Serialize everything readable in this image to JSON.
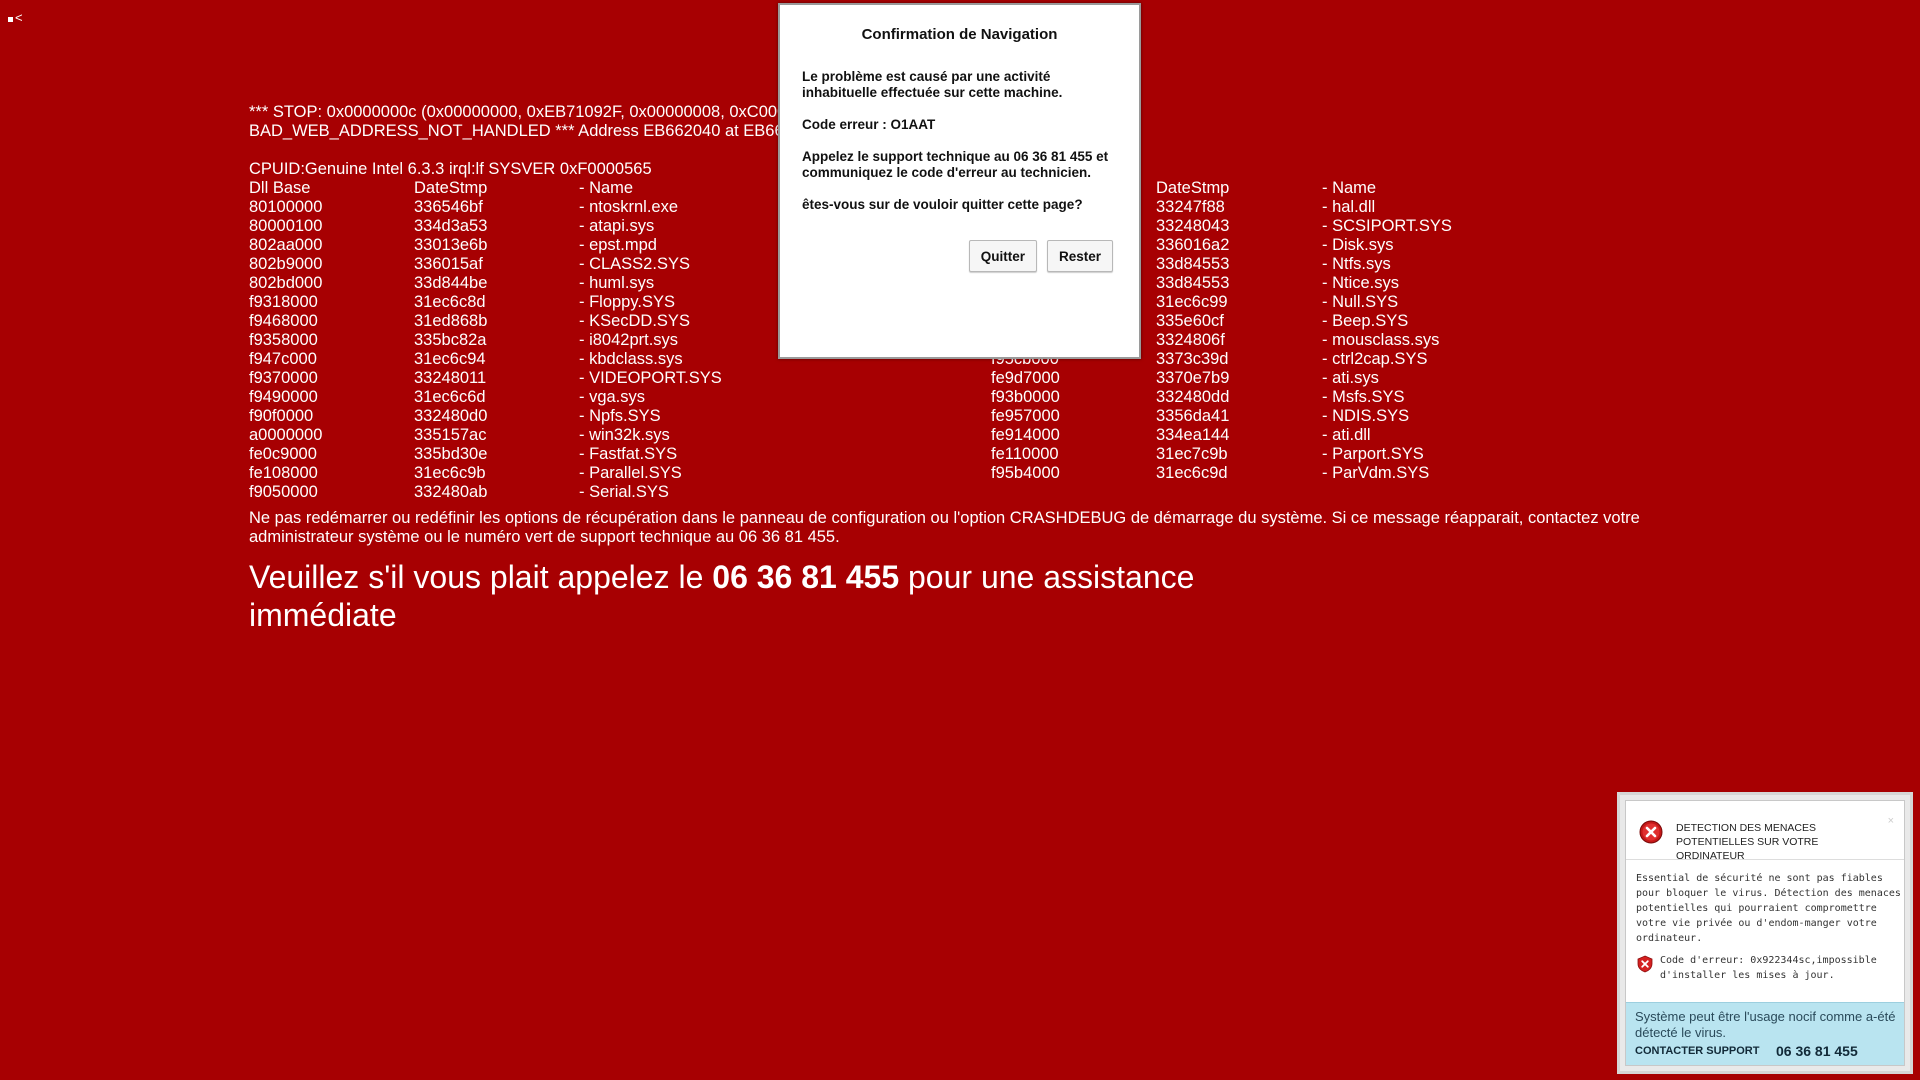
{
  "corner_glyph": "<",
  "bsod": {
    "stop_line_1": "*** STOP: 0x0000000c (0x00000000, 0xEB71092F, 0x00000008, 0xC00000",
    "stop_line_2": "BAD_WEB_ADDRESS_NOT_HANDLED *** Address EB662040 at EB660000",
    "cpuid": "CPUID:Genuine Intel 6.3.3 irql:lf SYSVER 0xF0000565",
    "headers": [
      "Dll Base",
      "DateStmp",
      "- Name",
      "",
      "DateStmp",
      "- Name"
    ],
    "rows": [
      [
        "80100000",
        "336546bf",
        "- ntoskrnl.exe",
        "",
        "33247f88",
        "- hal.dll"
      ],
      [
        "80000100",
        "334d3a53",
        "- atapi.sys",
        "",
        "33248043",
        "- SCSIPORT.SYS"
      ],
      [
        "802aa000",
        "33013e6b",
        "- epst.mpd",
        "",
        "336016a2",
        "- Disk.sys"
      ],
      [
        "802b9000",
        "336015af",
        "- CLASS2.SYS",
        "",
        "33d84553",
        "- Ntfs.sys"
      ],
      [
        "802bd000",
        "33d844be",
        "- huml.sys",
        "",
        "33d84553",
        "- Ntice.sys"
      ],
      [
        "f9318000",
        "31ec6c8d",
        "- Floppy.SYS",
        "",
        "31ec6c99",
        "- Null.SYS"
      ],
      [
        "f9468000",
        "31ed868b",
        "- KSecDD.SYS",
        "",
        "335e60cf",
        "- Beep.SYS"
      ],
      [
        "f9358000",
        "335bc82a",
        "- i8042prt.sys",
        "",
        "3324806f",
        "- mousclass.sys"
      ],
      [
        "f947c000",
        "31ec6c94",
        "- kbdclass.sys",
        "f95cb000",
        "3373c39d",
        "- ctrl2cap.SYS"
      ],
      [
        "f9370000",
        "33248011",
        "- VIDEOPORT.SYS",
        "fe9d7000",
        "3370e7b9",
        "- ati.sys"
      ],
      [
        "f9490000",
        "31ec6c6d",
        "- vga.sys",
        "f93b0000",
        "332480dd",
        "- Msfs.SYS"
      ],
      [
        "f90f0000",
        "332480d0",
        "- Npfs.SYS",
        "fe957000",
        "3356da41",
        "- NDIS.SYS"
      ],
      [
        "a0000000",
        "335157ac",
        "- win32k.sys",
        "fe914000",
        "334ea144",
        "- ati.dll"
      ],
      [
        "fe0c9000",
        "335bd30e",
        "- Fastfat.SYS",
        "fe110000",
        "31ec7c9b",
        "- Parport.SYS"
      ],
      [
        "fe108000",
        "31ec6c9b",
        "- Parallel.SYS",
        "f95b4000",
        "31ec6c9d",
        "- ParVdm.SYS"
      ],
      [
        "f9050000",
        "332480ab",
        "- Serial.SYS",
        "",
        "",
        ""
      ]
    ],
    "notice": "Ne pas redémarrer ou redéfinir les options de récupération dans le panneau de configuration ou l'option CRASHDEBUG de démarrage du système. Si ce message réapparait, contactez votre administrateur système ou le numéro vert de support technique au 06 36 81 455.",
    "call_prefix": "Veuillez s'il vous plait appelez le ",
    "call_phone": "06 36 81 455",
    "call_suffix": " pour une assistance immédiate"
  },
  "dialog": {
    "title": "Confirmation de Navigation",
    "p1": "Le problème est causé par une activité inhabituelle effectuée sur cette machine.",
    "p2": "Code erreur : O1AAT",
    "p3": "Appelez le support technique au 06 36 81 455 et communiquez le code d'erreur au technicien.",
    "p4": "êtes-vous sur de vouloir quitter cette page?",
    "quit_label": "Quitter",
    "stay_label": "Rester"
  },
  "popup": {
    "title": "DETECTION DES MENACES POTENTIELLES SUR VOTRE ORDINATEUR",
    "close": "×",
    "description": "Essential de sécurité ne sont pas fiables pour bloquer le virus. Détection des menaces potentielles qui pourraient compromettre votre vie privée ou d'endom-manger votre ordinateur.",
    "error": "Code d'erreur: 0x922344sc,impossible d'installer les mises à jour.",
    "footer_text": "Système peut être l'usage nocif comme a-été détecté le virus.",
    "support_label": "CONTACTER SUPPORT",
    "support_phone": "06 36 81 455"
  },
  "colors": {
    "background": "#a70002",
    "text": "#ffffff",
    "dialog_bg": "#ffffff",
    "popup_footer": "#b9e4f0",
    "error_red": "#d42020"
  },
  "icons": {
    "popup_header_icon": "error-x-icon",
    "popup_error_icon": "shield-x-icon"
  }
}
